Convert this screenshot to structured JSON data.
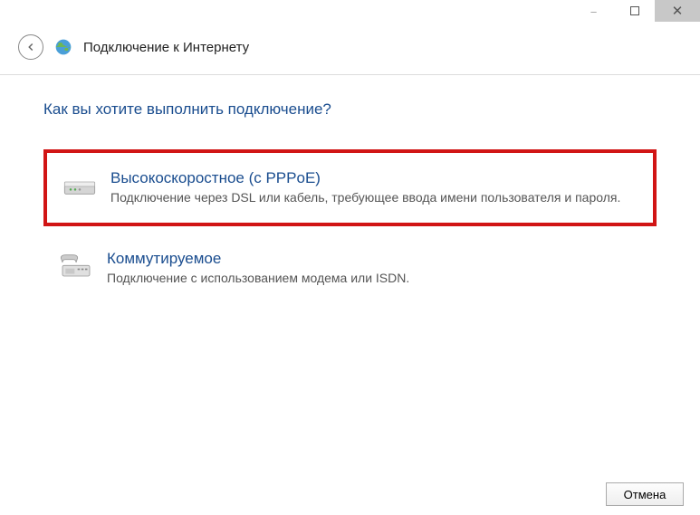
{
  "window": {
    "minimize": "–",
    "maximize": "□",
    "close": "✕"
  },
  "header": {
    "title": "Подключение к Интернету"
  },
  "content": {
    "question": "Как вы хотите выполнить подключение?",
    "options": [
      {
        "title": "Высокоскоростное (с PPPoE)",
        "desc": "Подключение через DSL или кабель, требующее ввода имени пользователя и пароля.",
        "highlighted": true
      },
      {
        "title": "Коммутируемое",
        "desc": "Подключение с использованием модема или ISDN.",
        "highlighted": false
      }
    ]
  },
  "footer": {
    "cancel": "Отмена"
  }
}
